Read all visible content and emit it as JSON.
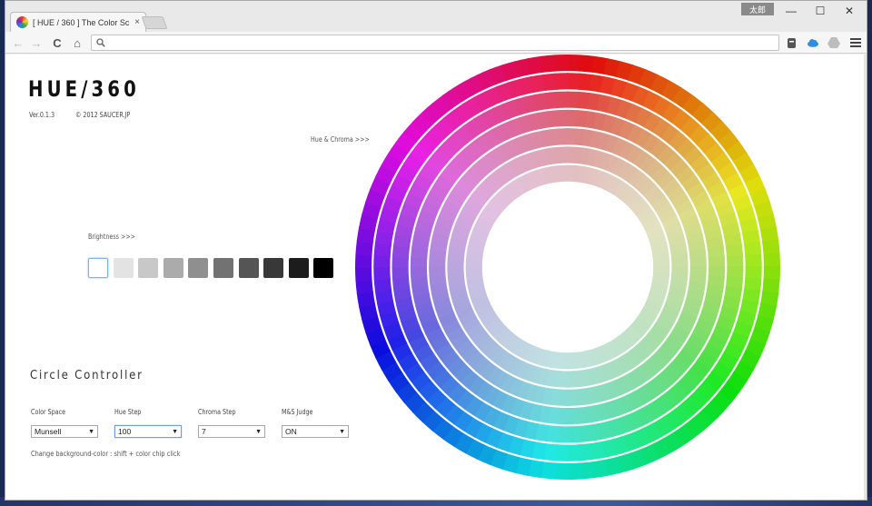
{
  "browser": {
    "tab_title": "[ HUE / 360 ] The Color Sc",
    "tab_close": "×",
    "user_badge": "太郎",
    "window_controls": {
      "minimize": "—",
      "maximize": "☐",
      "close": "✕"
    },
    "nav": {
      "back": "←",
      "forward": "→",
      "reload": "C",
      "home": "⌂"
    },
    "omnibox_value": "",
    "icons": [
      "evernote-icon",
      "cloud-icon",
      "drive-icon",
      "menu-icon"
    ]
  },
  "page": {
    "title": "HUE/360",
    "version": "Ver.0.1.3",
    "copyright": "© 2012 SAUCER.JP",
    "hue_chroma_link": "Hue & Chroma >>>",
    "brightness_link": "Brightness >>>",
    "brightness_swatches": [
      "#ffffff",
      "#e3e3e3",
      "#c8c8c8",
      "#ababab",
      "#8f8f8f",
      "#727272",
      "#555555",
      "#383838",
      "#1c1c1c",
      "#000000"
    ],
    "selected_swatch_index": 0,
    "controller_title": "Circle Controller",
    "controls": [
      {
        "label": "Color Space",
        "value": "Munsell"
      },
      {
        "label": "Hue Step",
        "value": "100"
      },
      {
        "label": "Chroma Step",
        "value": "7"
      },
      {
        "label": "M&S Judge",
        "value": "ON"
      }
    ],
    "hint": "Change background-color : shift + color chip click"
  },
  "wheel": {
    "hue_step": 100,
    "chroma_step": 7,
    "hue_start_color": "#d62a2a",
    "center_color": "#ffffff"
  }
}
